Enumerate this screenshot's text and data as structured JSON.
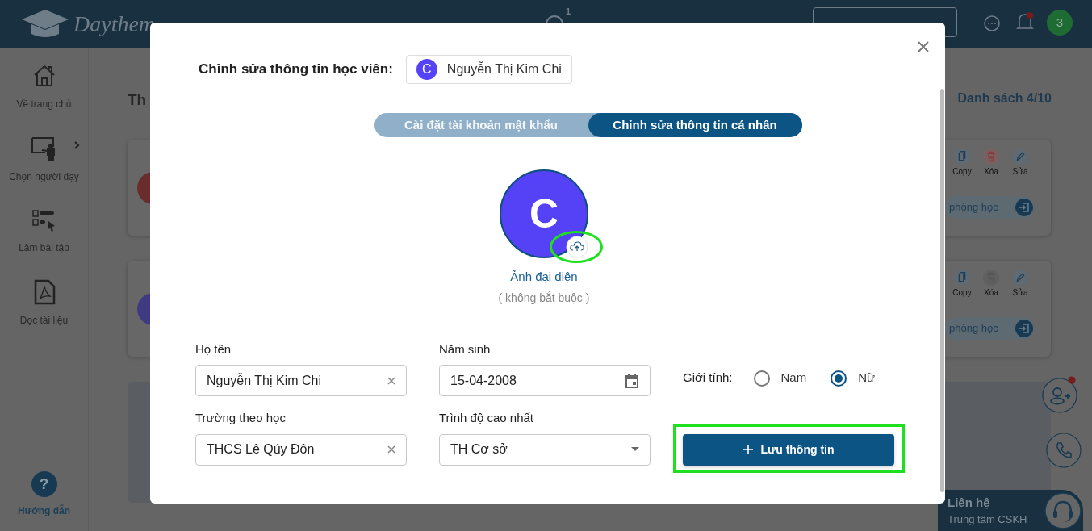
{
  "header": {
    "logo": "Daythem",
    "messages_badge": "1",
    "avatar": "3"
  },
  "sidebar": {
    "items": [
      {
        "label": "Về trang chủ",
        "has_submenu": false
      },
      {
        "label": "Chọn người dạy",
        "has_submenu": true
      },
      {
        "label": "Làm bài tập",
        "has_submenu": false
      },
      {
        "label": "Đọc tài liệu",
        "has_submenu": false
      }
    ],
    "help_icon": "?",
    "help": "Hướng dẫn"
  },
  "main": {
    "title": "Th",
    "list_count": "Danh sách 4/10",
    "cards": [
      {
        "kind": "student",
        "color": "#6b2c2c",
        "actions": [
          {
            "label": "Copy",
            "enabled": true
          },
          {
            "label": "Xóa",
            "enabled": true
          },
          {
            "label": "Sửa",
            "enabled": true
          }
        ],
        "room_button": "phòng học"
      },
      {
        "kind": "student",
        "color": "#3f3a82",
        "actions": [
          {
            "label": "Copy",
            "enabled": true
          },
          {
            "label": "Xóa",
            "enabled": false
          },
          {
            "label": "Sửa",
            "enabled": true
          }
        ],
        "room_button": "phòng học"
      },
      {
        "kind": "empty"
      }
    ]
  },
  "contact": {
    "title": "Liên hệ",
    "subtitle": "Trung tâm CSKH"
  },
  "modal": {
    "title": "Chỉnh sửa thông tin học viên:",
    "student": {
      "initial": "C",
      "name": "Nguyễn Thị Kim Chi"
    },
    "tabs": [
      {
        "label": "Cài đặt tài khoản mật khẩu",
        "selected": false
      },
      {
        "label": "Chỉnh sửa thông tin cá nhân",
        "selected": true
      }
    ],
    "avatar": {
      "initial": "C",
      "label": "Ảnh đại diện",
      "hint": "( không bắt buộc )",
      "upload_highlighted": true
    },
    "form": [
      {
        "kind": "text",
        "label": "Họ tên",
        "value": "Nguyễn Thị Kim Chi"
      },
      {
        "kind": "date",
        "label": "Năm sinh",
        "value": "15-04-2008"
      },
      {
        "kind": "radio",
        "label": "Giới tính:",
        "options": [
          {
            "label": "Nam",
            "selected": false
          },
          {
            "label": "Nữ",
            "selected": true
          }
        ]
      },
      {
        "kind": "text",
        "label": "Trường theo học",
        "value": "THCS Lê Qúy Đôn"
      },
      {
        "kind": "select",
        "label": "Trình độ cao nhất",
        "value": "TH Cơ sở"
      },
      {
        "kind": "button",
        "label": "Lưu thông tin",
        "highlighted": true
      }
    ]
  }
}
